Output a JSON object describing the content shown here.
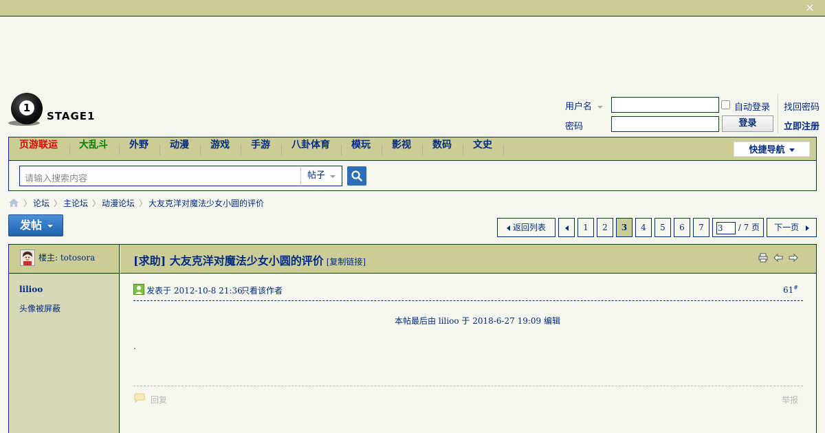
{
  "topbar": {
    "close_icon": "close-icon"
  },
  "logo": {
    "text": "STAGE1",
    "ball_digit": "1"
  },
  "login": {
    "username_label": "用户名",
    "password_label": "密码",
    "username_value": "",
    "password_value": "",
    "auto_login_label": "自动登录",
    "login_button": "登录",
    "find_password": "找回密码",
    "register": "立即注册"
  },
  "nav": {
    "items": [
      "页游联运",
      "大乱斗",
      "外野",
      "动漫",
      "游戏",
      "手游",
      "八卦体育",
      "模玩",
      "影视",
      "数码",
      "文史"
    ],
    "highlight_colors": {
      "red": "#e60000",
      "green": "#008000"
    },
    "quick_nav": "快捷导航"
  },
  "search": {
    "placeholder": "请输入搜索内容",
    "type": "帖子"
  },
  "breadcrumb": {
    "items": [
      "论坛",
      "主论坛",
      "动漫论坛",
      "大友克洋对魔法少女小圆的评价"
    ]
  },
  "post_button": "发帖",
  "pager": {
    "back_to_list": "返回列表",
    "pages": [
      "1",
      "2",
      "3",
      "4",
      "5",
      "6",
      "7"
    ],
    "current": "3",
    "input_value": "3",
    "total": "/ 7 页",
    "next": "下一页"
  },
  "thread": {
    "owner_label": "楼主: totosora",
    "title": "[求助] 大友克洋对魔法少女小圆的评价",
    "copy_link": "[复制链接]",
    "post": {
      "author": "lilioo",
      "avatar_note": "头像被屏蔽",
      "posted_at": "发表于 2012-10-8 21:36",
      "only_author": "只看该作者",
      "floor": "61",
      "floor_mark": "#",
      "edit_note": "本帖最后由 lilioo 于 2018-6-27 19:09 编辑",
      "content": ".",
      "reply": "回复",
      "report": "举报"
    }
  },
  "colors": {
    "accent": "#022c80",
    "bar": "#cbcc96",
    "page_bg": "#f5f6ee",
    "post_button": "#2d6fb7"
  }
}
